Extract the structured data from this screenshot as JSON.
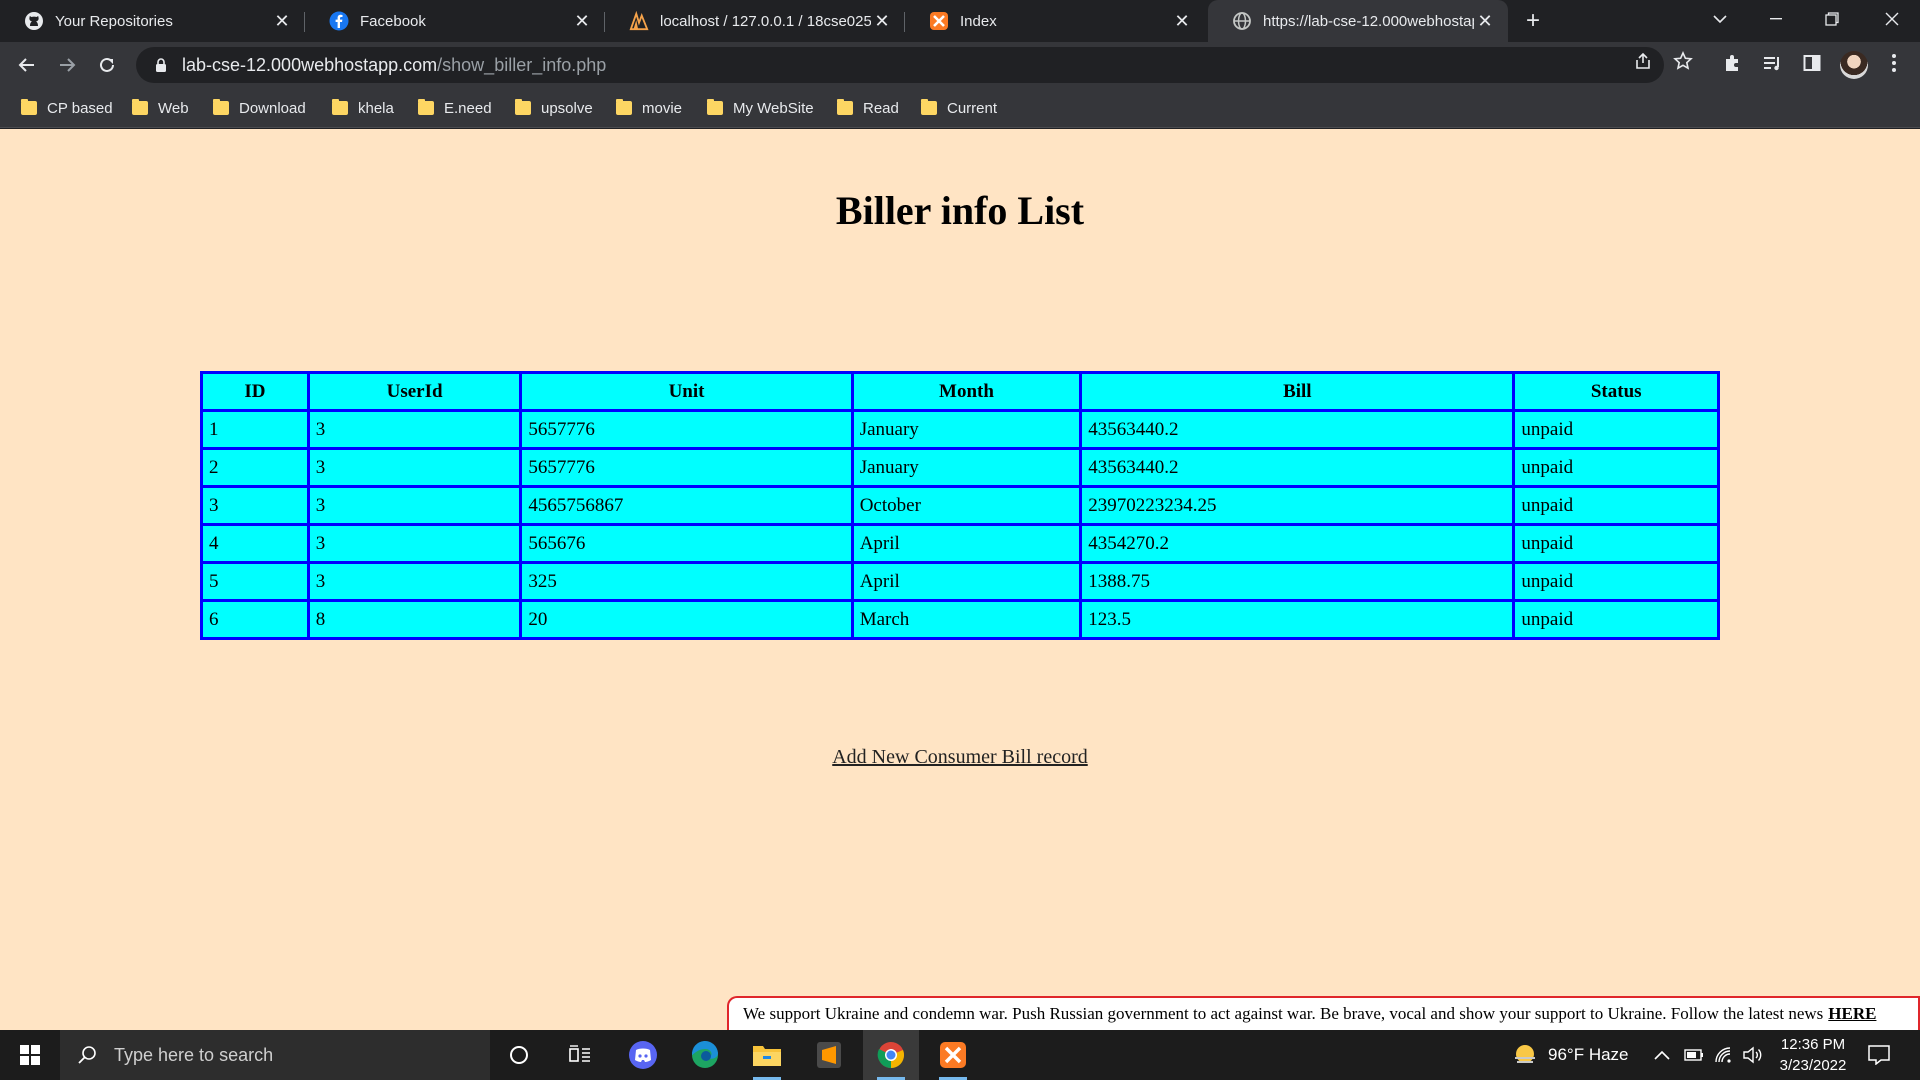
{
  "tabs": [
    {
      "title": "Your Repositories",
      "icon": "github-icon"
    },
    {
      "title": "Facebook",
      "icon": "facebook-icon"
    },
    {
      "title": "localhost / 127.0.0.1 / 18cse025 |",
      "icon": "phpmyadmin-icon"
    },
    {
      "title": "Index",
      "icon": "xampp-icon"
    },
    {
      "title": "https://lab-cse-12.000webhostap",
      "icon": "globe-icon",
      "active": true
    }
  ],
  "address": {
    "host": "lab-cse-12.000webhostapp.com",
    "path": "/show_biller_info.php"
  },
  "bookmarks": [
    "CP based",
    "Web",
    "Download",
    "khela",
    "E.need",
    "upsolve",
    "movie",
    "My WebSite",
    "Read",
    "Current"
  ],
  "page": {
    "title": "Biller info List",
    "table": {
      "headers": [
        "ID",
        "UserId",
        "Unit",
        "Month",
        "Bill",
        "Status"
      ],
      "rows": [
        [
          "1",
          "3",
          "5657776",
          "January",
          "43563440.2",
          "unpaid"
        ],
        [
          "2",
          "3",
          "5657776",
          "January",
          "43563440.2",
          "unpaid"
        ],
        [
          "3",
          "3",
          "4565756867",
          "October",
          "23970223234.25",
          "unpaid"
        ],
        [
          "4",
          "3",
          "565676",
          "April",
          "4354270.2",
          "unpaid"
        ],
        [
          "5",
          "3",
          "325",
          "April",
          "1388.75",
          "unpaid"
        ],
        [
          "6",
          "8",
          "20",
          "March",
          "123.5",
          "unpaid"
        ]
      ]
    },
    "add_link": "Add New Consumer Bill record",
    "banner": {
      "text": "We support Ukraine and condemn war. Push Russian government to act against war. Be brave, vocal and show your support to Ukraine. Follow the latest news",
      "link": "HERE"
    }
  },
  "taskbar": {
    "search_placeholder": "Type here to search",
    "weather": "96°F  Haze",
    "time": "12:36 PM",
    "date": "3/23/2022"
  },
  "colors": {
    "page_bg": "#ffe4c4",
    "table_bg": "#00ffff",
    "table_border": "#0000ff",
    "banner_border": "#e0262b"
  }
}
